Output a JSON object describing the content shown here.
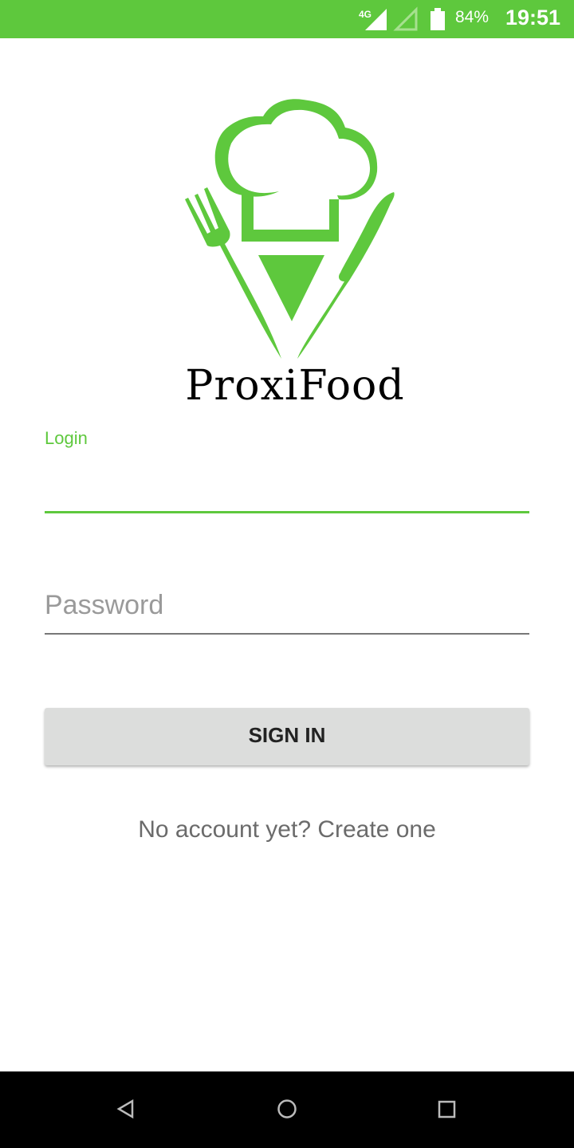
{
  "status_bar": {
    "network": "4G",
    "battery": "84%",
    "time": "19:51",
    "battery_level": 0.84
  },
  "logo": {
    "brand": "ProxiFood"
  },
  "form": {
    "login_label": "Login",
    "login_value": "",
    "password_placeholder": "Password",
    "sign_in": "SIGN IN",
    "create_account": "No account yet? Create one"
  },
  "colors": {
    "accent": "#5ec83d",
    "button": "#dcdddc"
  },
  "nav": {
    "icons": [
      "back-icon",
      "home-icon",
      "recents-icon"
    ]
  }
}
